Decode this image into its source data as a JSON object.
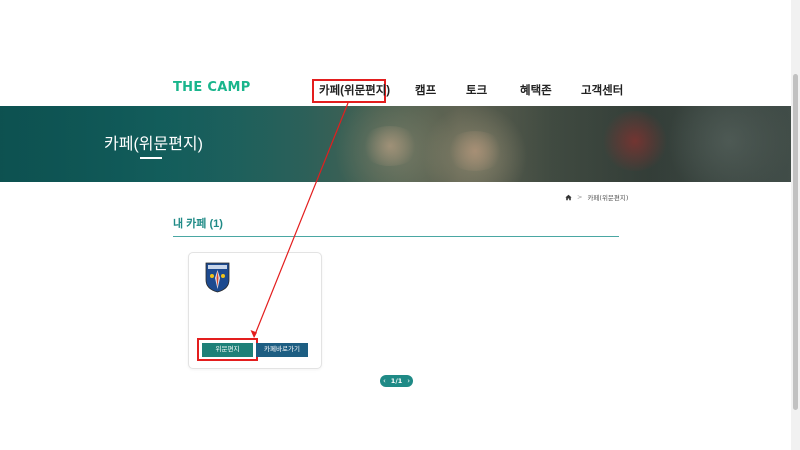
{
  "header": {
    "logo": "THE CAMP",
    "nav": [
      {
        "label": "카페(위문편지)",
        "active": true
      },
      {
        "label": "캠프"
      },
      {
        "label": "토크"
      },
      {
        "label": "혜택존"
      },
      {
        "label": "고객센터"
      }
    ]
  },
  "banner": {
    "title": "카페(위문편지)"
  },
  "breadcrumb": {
    "home_icon": "home-icon",
    "separator": ">",
    "current": "카페(위문편지)"
  },
  "section": {
    "title": "내 카페 (1)"
  },
  "card": {
    "emblem_icon": "unit-emblem-icon",
    "letter_button": "위문편지",
    "cafe_button": "카페바로가기"
  },
  "pagination": {
    "prev": "‹",
    "current": "1",
    "slash": "/",
    "total": "1",
    "next": "›"
  },
  "colors": {
    "brand": "#19b58c",
    "accent": "#1f8a86",
    "letter_button": "#1e8078",
    "cafe_button": "#1d5e82",
    "annotation": "#e31e1e"
  }
}
